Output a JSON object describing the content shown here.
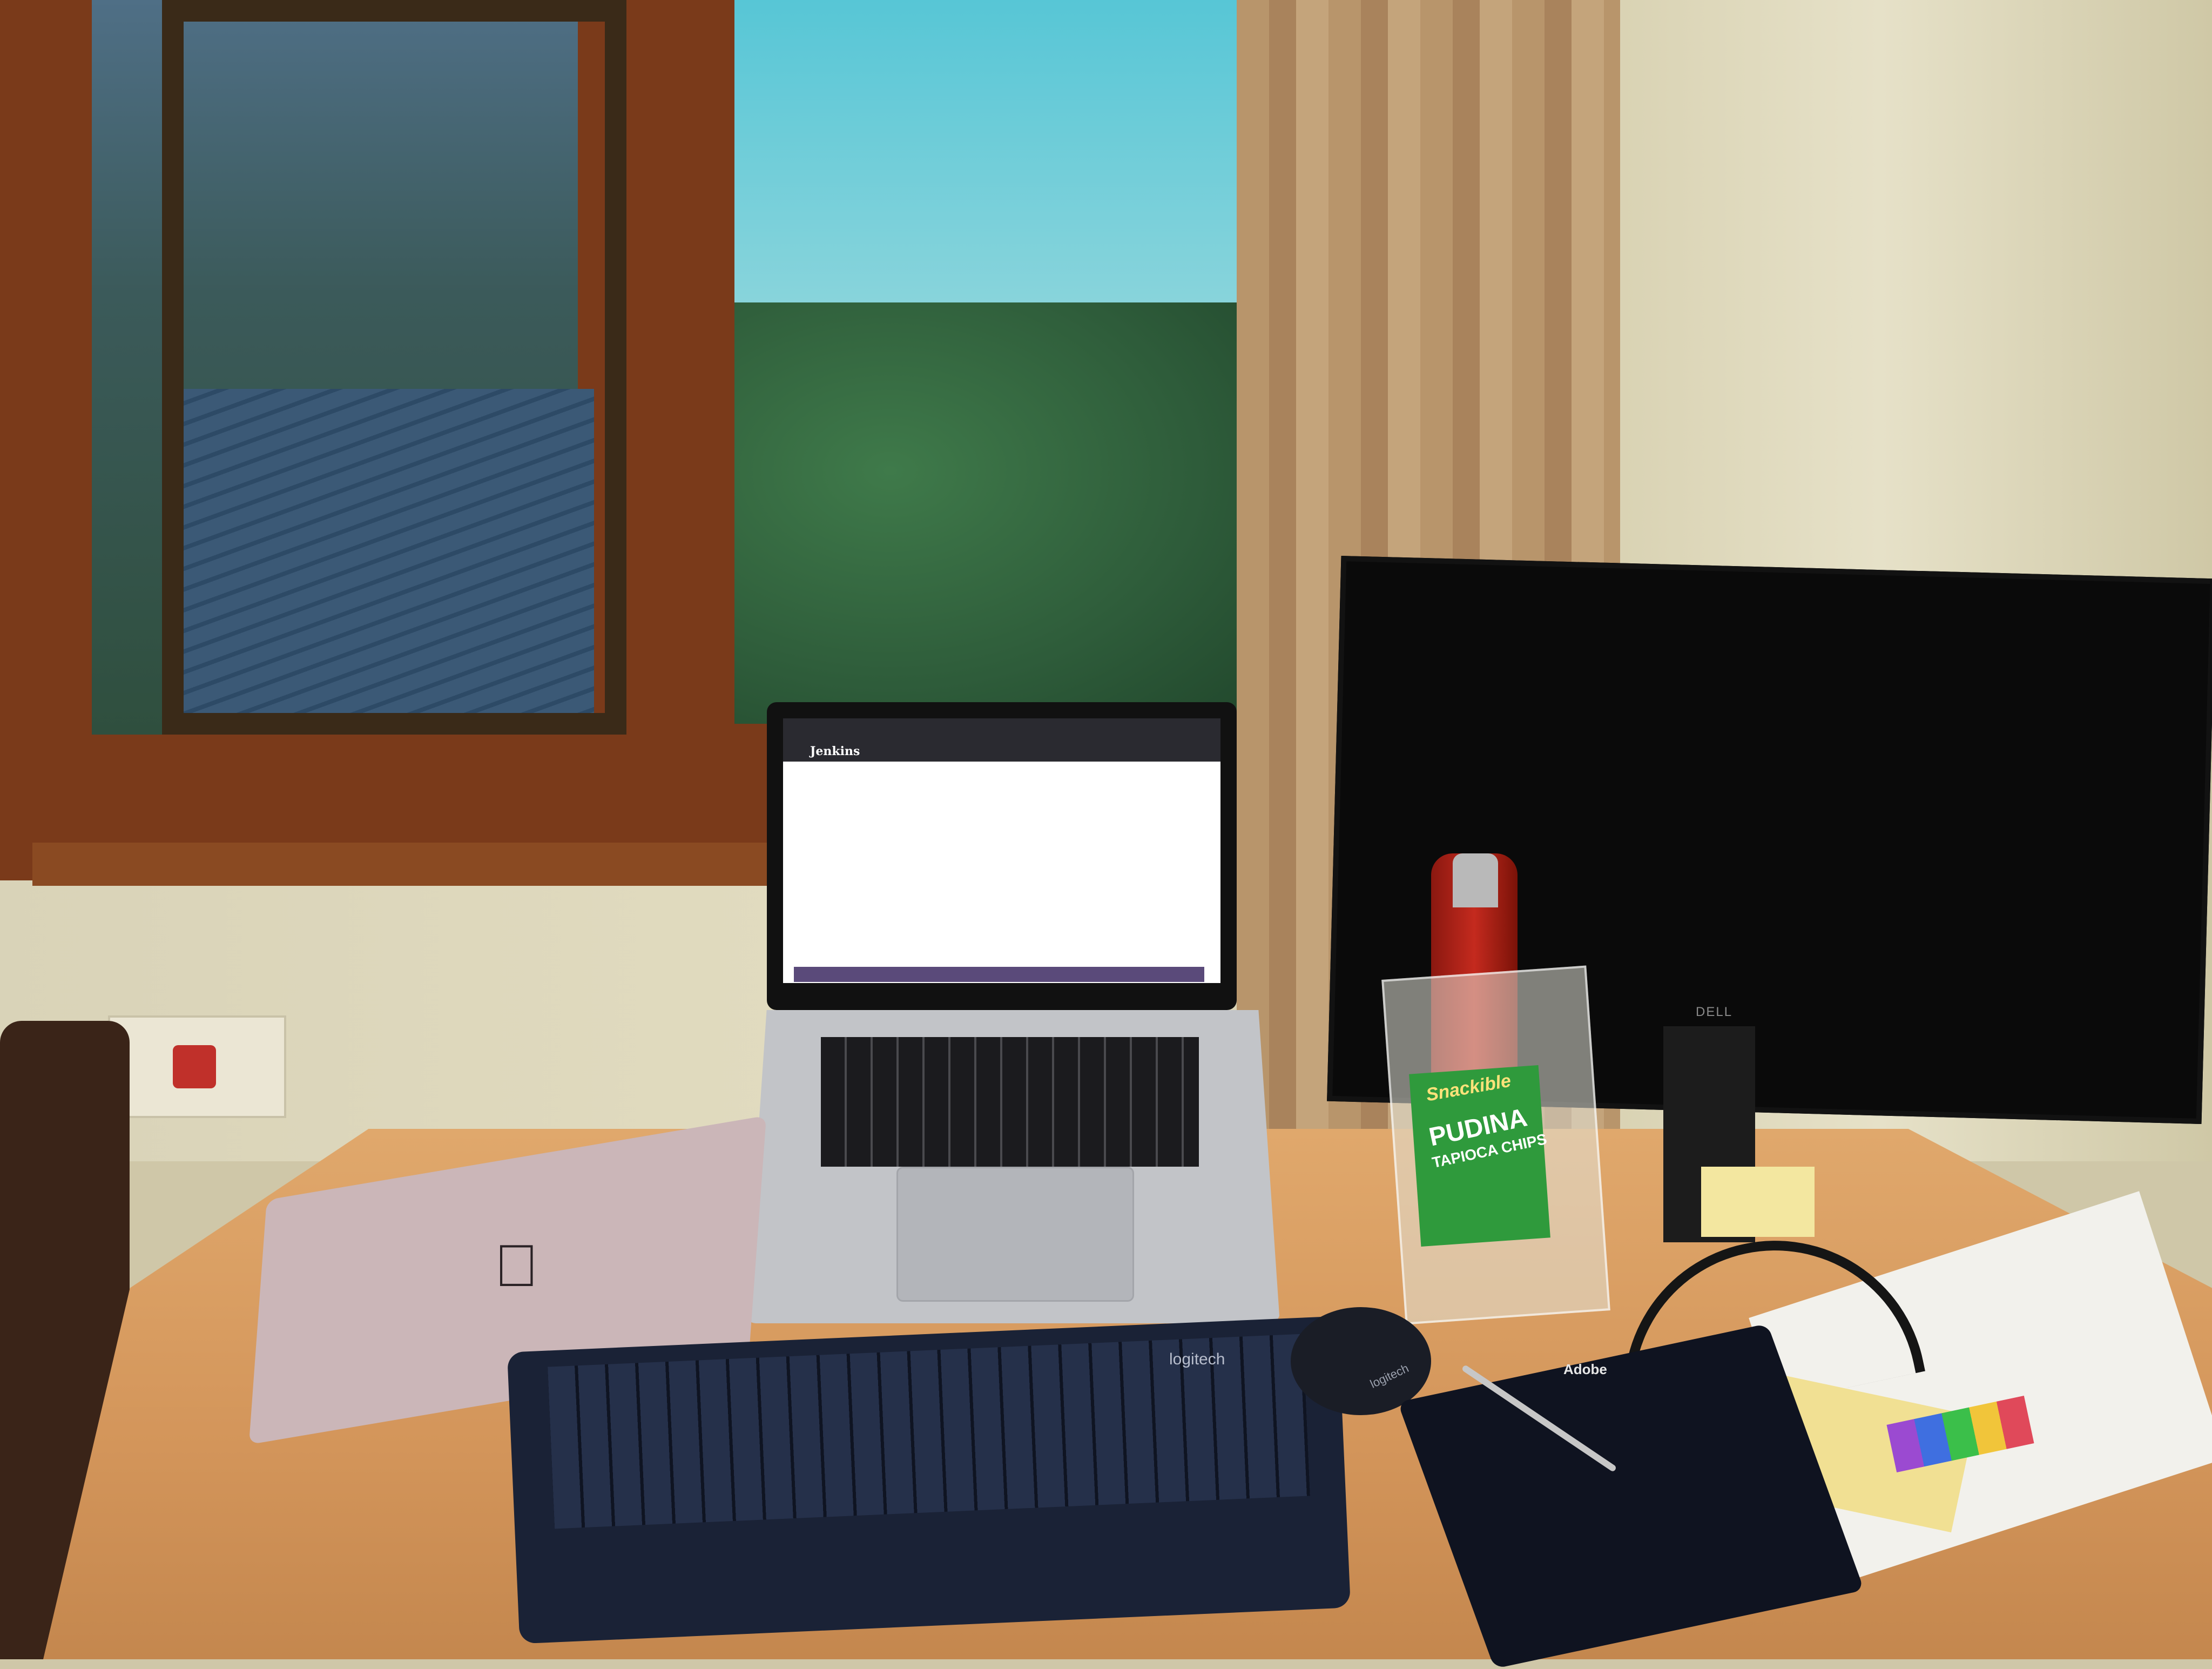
{
  "scene": {
    "colors": {
      "wall": "#e2dcc0",
      "window_frame": "#7a3a1a",
      "sky": "#57c6d6",
      "desk": "#d3955a",
      "monitor": "#0a0a0a",
      "bottle": "#c42a1e",
      "chips_label": "#2f9a3c",
      "keyboard": "#1a2236"
    }
  },
  "laptop": {
    "browser_title": "Jenkins"
  },
  "closed_laptop": {
    "logo_glyph": ""
  },
  "monitor": {
    "brand": "DELL"
  },
  "chips": {
    "brand": "Snackible",
    "name": "PUDINA",
    "sub": "TAPIOCA CHIPS"
  },
  "keyboard": {
    "brand": "logitech"
  },
  "mouse": {
    "brand": "logitech"
  },
  "notebook": {
    "brand": "Adobe"
  }
}
